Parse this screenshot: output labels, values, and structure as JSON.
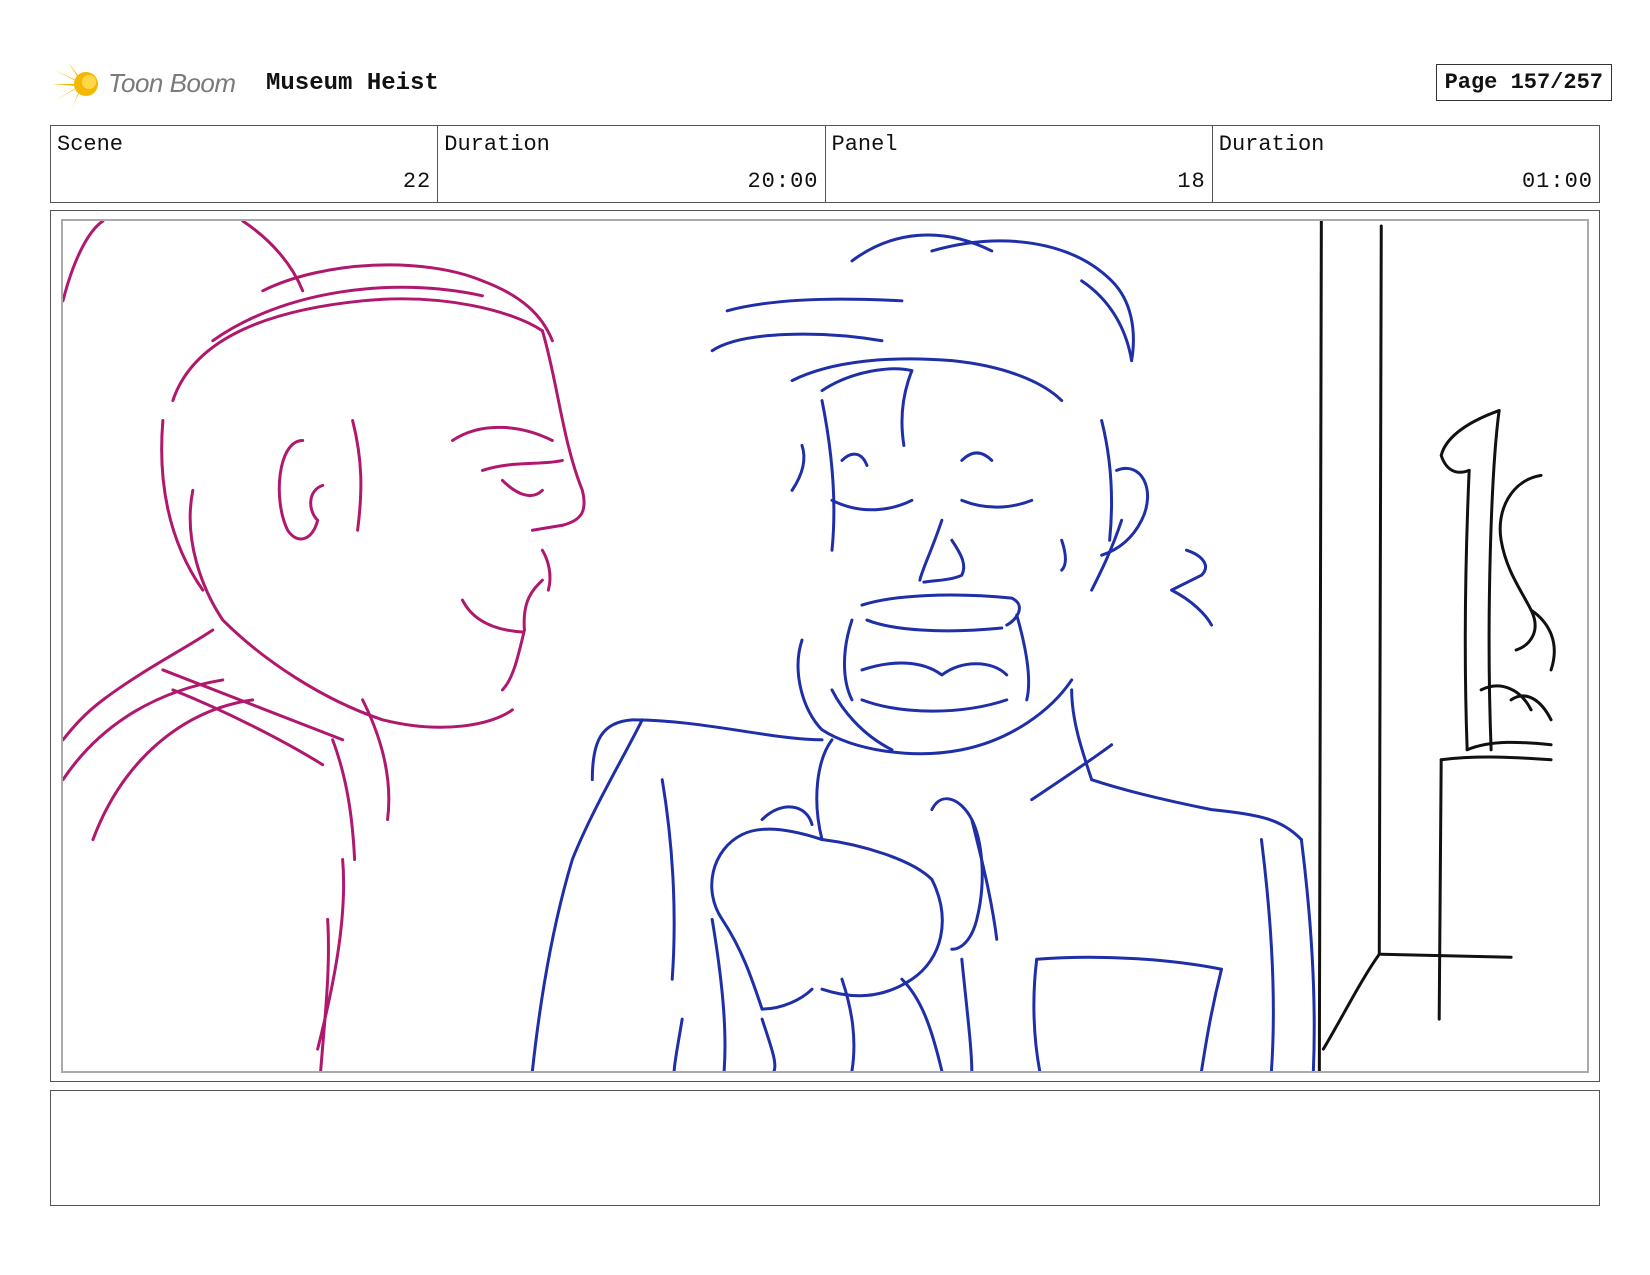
{
  "header": {
    "logo_text": "Toon Boom",
    "project_title": "Museum Heist",
    "page_label": "Page 157/257"
  },
  "info": {
    "scene_label": "Scene",
    "scene_value": "22",
    "scene_duration_label": "Duration",
    "scene_duration_value": "20:00",
    "panel_label": "Panel",
    "panel_value": "18",
    "panel_duration_label": "Duration",
    "panel_duration_value": "01:00"
  },
  "notes": {
    "text": ""
  },
  "colors": {
    "character_left": "#b0186e",
    "character_right": "#1e2fa8",
    "background_lines": "#111111",
    "logo_star": "#f5b800"
  }
}
